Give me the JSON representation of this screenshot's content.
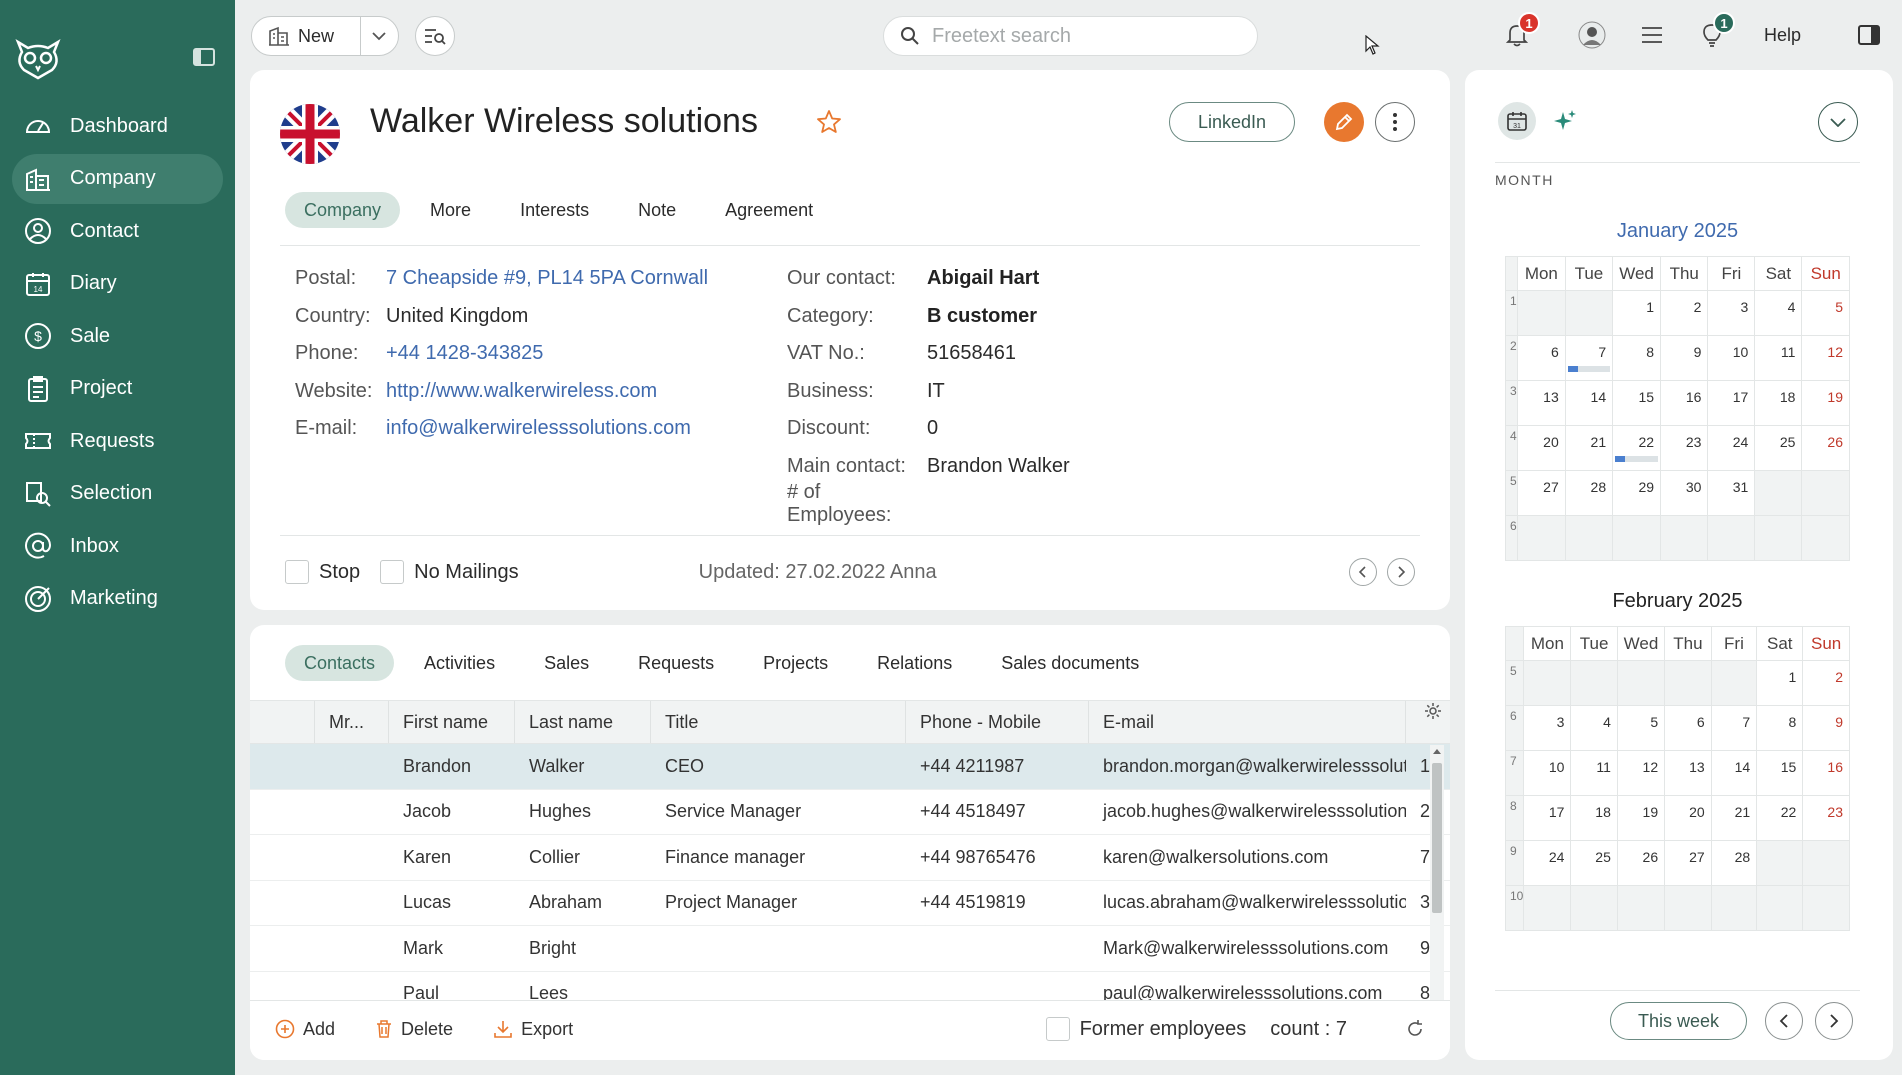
{
  "sidebar": {
    "items": [
      {
        "label": "Dashboard",
        "icon": "dashboard-icon"
      },
      {
        "label": "Company",
        "icon": "company-icon",
        "active": true
      },
      {
        "label": "Contact",
        "icon": "contact-icon"
      },
      {
        "label": "Diary",
        "icon": "diary-icon"
      },
      {
        "label": "Sale",
        "icon": "sale-icon"
      },
      {
        "label": "Project",
        "icon": "project-icon"
      },
      {
        "label": "Requests",
        "icon": "requests-icon"
      },
      {
        "label": "Selection",
        "icon": "selection-icon"
      },
      {
        "label": "Inbox",
        "icon": "inbox-icon"
      },
      {
        "label": "Marketing",
        "icon": "marketing-icon"
      }
    ],
    "bg_color": "#2a6b5b"
  },
  "topbar": {
    "new_label": "New",
    "search_placeholder": "Freetext search",
    "notifications_count": "1",
    "tips_count": "1",
    "help_label": "Help"
  },
  "company": {
    "name": "Walker Wireless solutions",
    "linkedin_label": "LinkedIn",
    "tabs": [
      "Company",
      "More",
      "Interests",
      "Note",
      "Agreement"
    ],
    "left_fields": [
      {
        "label": "Postal:",
        "value": "7 Cheapside #9, PL14 5PA Cornwall",
        "link": true
      },
      {
        "label": "Country:",
        "value": "United Kingdom"
      },
      {
        "label": "Phone:",
        "value": "+44 1428-343825",
        "link": true
      },
      {
        "label": "Website:",
        "value": "http://www.walkerwireless.com",
        "link": true
      },
      {
        "label": "E-mail:",
        "value": "info@walkerwirelesssolutions.com",
        "link": true
      }
    ],
    "right_fields": [
      {
        "label": "Our contact:",
        "value": "Abigail Hart",
        "bold": true
      },
      {
        "label": "Category:",
        "value": "B customer",
        "bold": true
      },
      {
        "label": "VAT No.:",
        "value": "51658461"
      },
      {
        "label": "Business:",
        "value": "IT"
      },
      {
        "label": "Discount:",
        "value": "0"
      },
      {
        "label": "Main contact:",
        "value": "Brandon Walker"
      },
      {
        "label": "# of Employees:",
        "value": ""
      }
    ],
    "stop_label": "Stop",
    "no_mailings_label": "No Mailings",
    "updated": "Updated: 27.02.2022 Anna"
  },
  "contacts": {
    "tabs": [
      "Contacts",
      "Activities",
      "Sales",
      "Requests",
      "Projects",
      "Relations",
      "Sales documents"
    ],
    "columns": [
      "",
      "Mr...",
      "First name",
      "Last name",
      "Title",
      "Phone - Mobile",
      "E-mail"
    ],
    "rows": [
      {
        "first": "Brandon",
        "last": "Walker",
        "title": "CEO",
        "phone": "+44 4211987",
        "email": "brandon.morgan@walkerwirelesssolutions.com",
        "extra": "1"
      },
      {
        "first": "Jacob",
        "last": "Hughes",
        "title": "Service Manager",
        "phone": "+44 4518497",
        "email": "jacob.hughes@walkerwirelesssolutions.com",
        "extra": "2"
      },
      {
        "first": "Karen",
        "last": "Collier",
        "title": "Finance manager",
        "phone": "+44 98765476",
        "email": "karen@walkersolutions.com",
        "extra": "7"
      },
      {
        "first": "Lucas",
        "last": "Abraham",
        "title": "Project Manager",
        "phone": "+44 4519819",
        "email": "lucas.abraham@walkerwirelesssolutions.com",
        "extra": "3"
      },
      {
        "first": "Mark",
        "last": "Bright",
        "title": "",
        "phone": "",
        "email": "Mark@walkerwirelesssolutions.com",
        "extra": "9"
      },
      {
        "first": "Paul",
        "last": "Lees",
        "title": "",
        "phone": "",
        "email": "paul@walkerwirelesssolutions.com",
        "extra": "8"
      }
    ],
    "add_label": "Add",
    "delete_label": "Delete",
    "export_label": "Export",
    "former_label": "Former employees",
    "count_label": "count : 7"
  },
  "calendar": {
    "mode_label": "MONTH",
    "weekdays": [
      "Mon",
      "Tue",
      "Wed",
      "Thu",
      "Fri",
      "Sat",
      "Sun"
    ],
    "months": [
      {
        "title": "January 2025",
        "weeks": [
          {
            "wk": "1",
            "days": [
              "",
              "",
              "1",
              "2",
              "3",
              "4",
              "5"
            ]
          },
          {
            "wk": "2",
            "days": [
              "6",
              "7",
              "8",
              "9",
              "10",
              "11",
              "12"
            ],
            "event_day": 1
          },
          {
            "wk": "3",
            "days": [
              "13",
              "14",
              "15",
              "16",
              "17",
              "18",
              "19"
            ]
          },
          {
            "wk": "4",
            "days": [
              "20",
              "21",
              "22",
              "23",
              "24",
              "25",
              "26"
            ],
            "event_day": 2
          },
          {
            "wk": "5",
            "days": [
              "27",
              "28",
              "29",
              "30",
              "31",
              "",
              ""
            ]
          },
          {
            "wk": "6",
            "days": [
              "",
              "",
              "",
              "",
              "",
              "",
              ""
            ]
          }
        ]
      },
      {
        "title": "February 2025",
        "weeks": [
          {
            "wk": "5",
            "days": [
              "",
              "",
              "",
              "",
              "",
              "1",
              "2"
            ]
          },
          {
            "wk": "6",
            "days": [
              "3",
              "4",
              "5",
              "6",
              "7",
              "8",
              "9"
            ]
          },
          {
            "wk": "7",
            "days": [
              "10",
              "11",
              "12",
              "13",
              "14",
              "15",
              "16"
            ]
          },
          {
            "wk": "8",
            "days": [
              "17",
              "18",
              "19",
              "20",
              "21",
              "22",
              "23"
            ]
          },
          {
            "wk": "9",
            "days": [
              "24",
              "25",
              "26",
              "27",
              "28",
              "",
              ""
            ]
          },
          {
            "wk": "10",
            "days": [
              "",
              "",
              "",
              "",
              "",
              "",
              ""
            ]
          }
        ]
      }
    ],
    "this_week_label": "This week",
    "title_color": "#3f6aae"
  },
  "colors": {
    "accent": "#2a6b5b",
    "edit": "#e8782f",
    "badge": "#d9342b",
    "tip_badge": "#2a6b5b",
    "link": "#3f6aae"
  }
}
